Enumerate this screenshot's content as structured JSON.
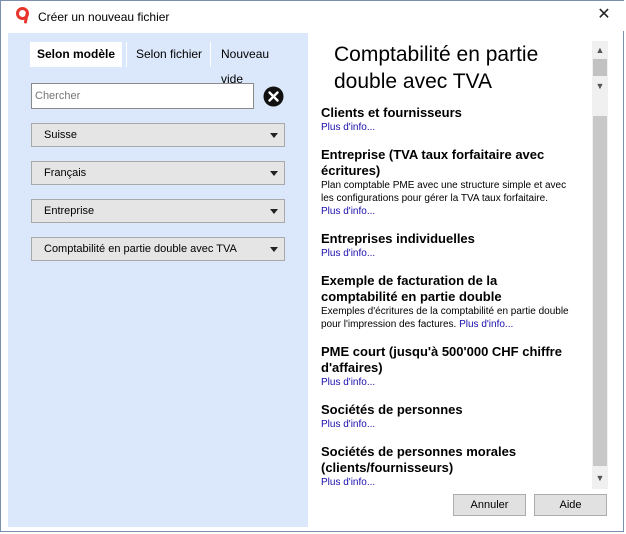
{
  "window": {
    "title": "Créer un nouveau fichier",
    "close_glyph": "✕"
  },
  "tabs": [
    {
      "label": "Selon modèle"
    },
    {
      "label": "Selon fichier"
    },
    {
      "label": "Nouveau vide"
    }
  ],
  "search": {
    "placeholder": "Chercher",
    "value": ""
  },
  "filters": [
    {
      "value": "Suisse"
    },
    {
      "value": "Français"
    },
    {
      "value": "Entreprise"
    },
    {
      "value": "Comptabilité en partie double avec TVA"
    }
  ],
  "detail": {
    "heading_line1": "Comptabilité en partie",
    "heading_line2": "double avec TVA",
    "items": [
      {
        "title_lines": [
          "Clients et fournisseurs"
        ],
        "desc_lines": [],
        "link": "Plus d'info..."
      },
      {
        "title_lines": [
          "Entreprise (TVA taux forfaitaire avec",
          "écritures)"
        ],
        "desc_lines": [
          "Plan comptable PME avec une structure simple et avec",
          "les configurations pour gérer la TVA taux forfaitaire."
        ],
        "link": "Plus d'info..."
      },
      {
        "title_lines": [
          "Entreprises individuelles"
        ],
        "desc_lines": [],
        "link": "Plus d'info..."
      },
      {
        "title_lines": [
          "Exemple de facturation de la",
          "comptabilité en partie double"
        ],
        "desc_lines": [
          "Exemples d'écritures de la comptabilité en partie double",
          "pour l'impression des factures."
        ],
        "link": "Plus d'info..."
      },
      {
        "title_lines": [
          "PME court (jusqu'à 500'000 CHF chiffre",
          "d'affaires)"
        ],
        "desc_lines": [],
        "link": "Plus d'info..."
      },
      {
        "title_lines": [
          "Sociétés de personnes"
        ],
        "desc_lines": [],
        "link": "Plus d'info..."
      },
      {
        "title_lines": [
          "Sociétés de personnes morales",
          "(clients/fournisseurs)"
        ],
        "desc_lines": [],
        "link": "Plus d'info..."
      }
    ]
  },
  "buttons": {
    "cancel": "Annuler",
    "help": "Aide"
  },
  "colors": {
    "panel": "#dbe7fb",
    "link": "#1a0dab",
    "app_icon": "#e8352b"
  }
}
